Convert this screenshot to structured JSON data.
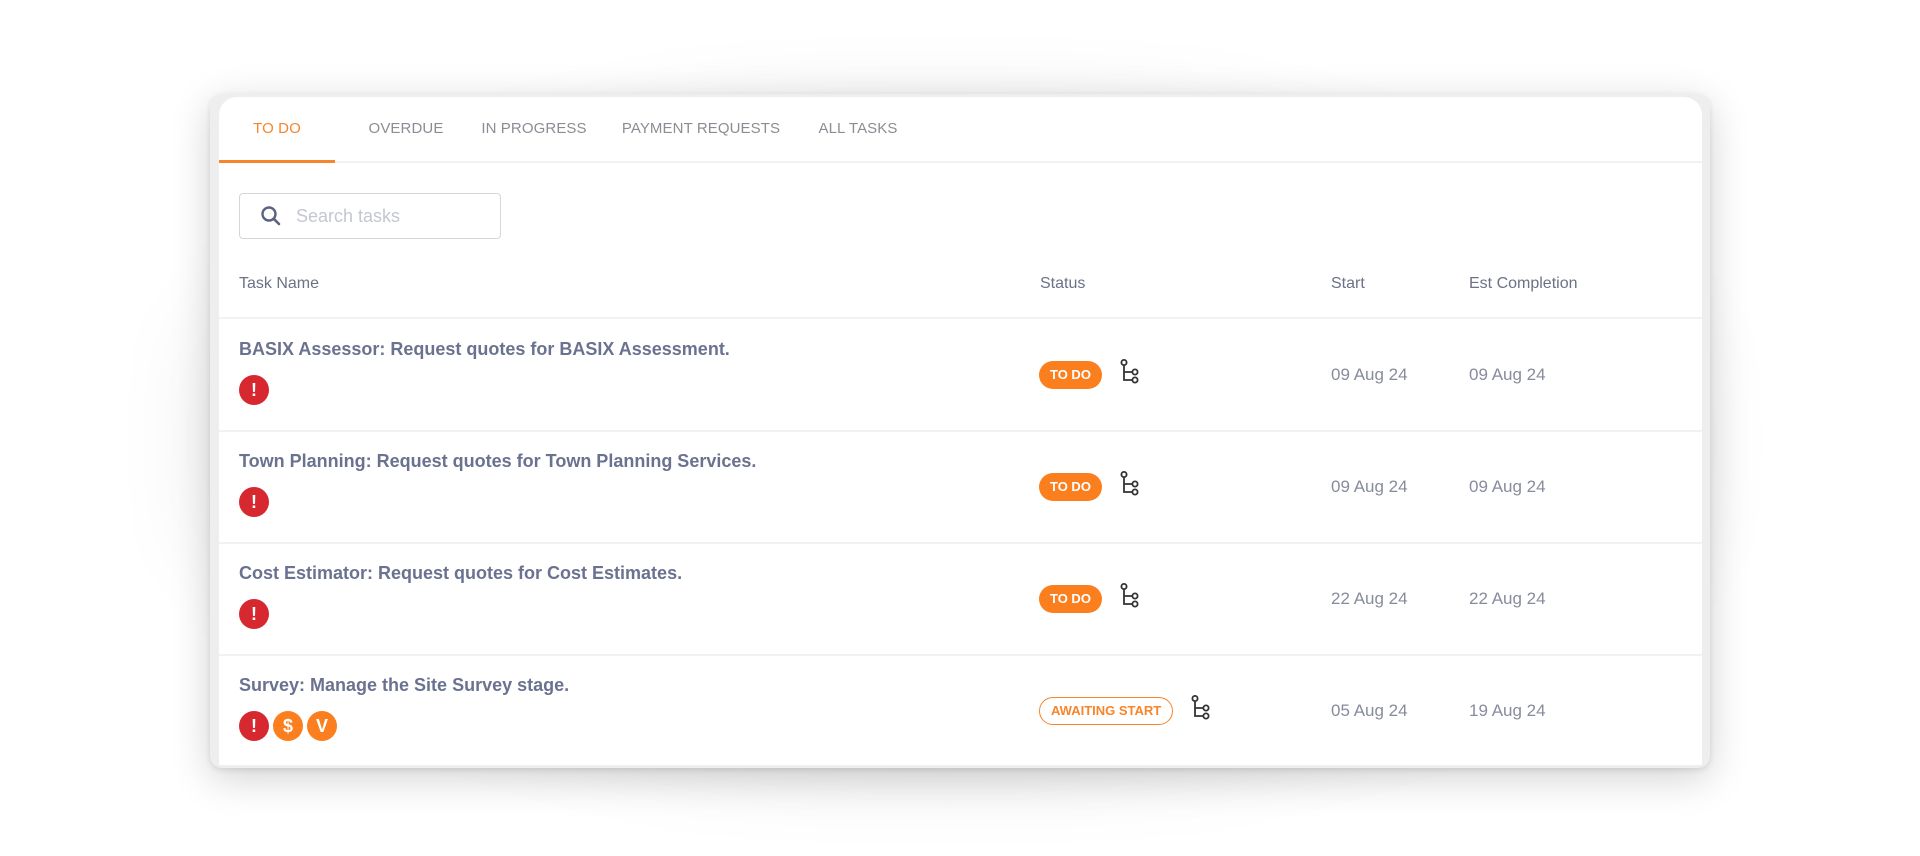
{
  "tabs": [
    {
      "label": "TO DO",
      "active": true
    },
    {
      "label": "OVERDUE",
      "active": false
    },
    {
      "label": "IN PROGRESS",
      "active": false
    },
    {
      "label": "PAYMENT REQUESTS",
      "active": false
    },
    {
      "label": "ALL TASKS",
      "active": false
    }
  ],
  "search": {
    "placeholder": "Search tasks",
    "value": "",
    "icon": "search-icon"
  },
  "columns": {
    "task_name": "Task Name",
    "status": "Status",
    "start": "Start",
    "est_completion": "Est Completion"
  },
  "colors": {
    "accent": "#f7852b",
    "alert": "#d6282e",
    "badge_orange": "#fb7f1e",
    "text_primary": "#6b7290",
    "text_muted": "#868c9c"
  },
  "rows": [
    {
      "name": "BASIX Assessor: Request quotes for BASIX Assessment.",
      "badges": [
        {
          "type": "alert",
          "glyph": "!"
        }
      ],
      "status": "TO DO",
      "status_style": "solid",
      "start": "09 Aug 24",
      "est_completion": "09 Aug 24"
    },
    {
      "name": "Town Planning: Request quotes for Town Planning Services.",
      "badges": [
        {
          "type": "alert",
          "glyph": "!"
        }
      ],
      "status": "TO DO",
      "status_style": "solid",
      "start": "09 Aug 24",
      "est_completion": "09 Aug 24"
    },
    {
      "name": "Cost Estimator: Request quotes for Cost Estimates.",
      "badges": [
        {
          "type": "alert",
          "glyph": "!"
        }
      ],
      "status": "TO DO",
      "status_style": "solid",
      "start": "22 Aug 24",
      "est_completion": "22 Aug 24"
    },
    {
      "name": "Survey: Manage the Site Survey stage.",
      "badges": [
        {
          "type": "alert",
          "glyph": "!"
        },
        {
          "type": "payment",
          "glyph": "$"
        },
        {
          "type": "variation",
          "glyph": "V"
        }
      ],
      "status": "AWAITING START",
      "status_style": "outline",
      "start": "05 Aug 24",
      "est_completion": "19 Aug 24"
    }
  ]
}
